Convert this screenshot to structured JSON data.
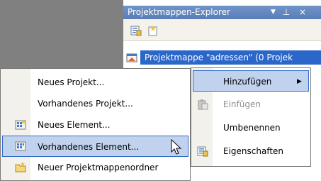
{
  "explorer": {
    "title": "Projektmappen-Explorer",
    "dropdown_glyph": "▼",
    "pin_glyph": "⊥",
    "close_glyph": "×",
    "solution_label": "Projektmappe \"adressen\" (0 Projek",
    "toolbar_icons": [
      "properties-icon",
      "show-all-files-icon"
    ]
  },
  "context_menu": {
    "items": [
      {
        "label": "Neues Projekt...",
        "icon": null
      },
      {
        "label": "Vorhandenes Projekt...",
        "icon": null
      },
      {
        "label": "Neues Element...",
        "icon": "new-item-icon"
      },
      {
        "label": "Vorhandenes Element...",
        "icon": "existing-item-icon",
        "highlighted": true
      },
      {
        "label": "Neuer Projektmappenordner",
        "icon": "solution-folder-icon"
      }
    ]
  },
  "submenu": {
    "items": [
      {
        "label": "Hinzufügen",
        "highlighted": true,
        "arrow": "▶"
      },
      {
        "label": "Einfügen",
        "disabled": true,
        "icon": "paste-icon"
      },
      {
        "label": "Umbenennen"
      },
      {
        "label": "Eigenschaften",
        "icon": "properties-icon"
      }
    ]
  },
  "colors": {
    "title_bar": "#5a7db8",
    "selection": "#2b66c9",
    "menu_highlight": "#c1d2ee",
    "menu_highlight_border": "#316ac5"
  }
}
